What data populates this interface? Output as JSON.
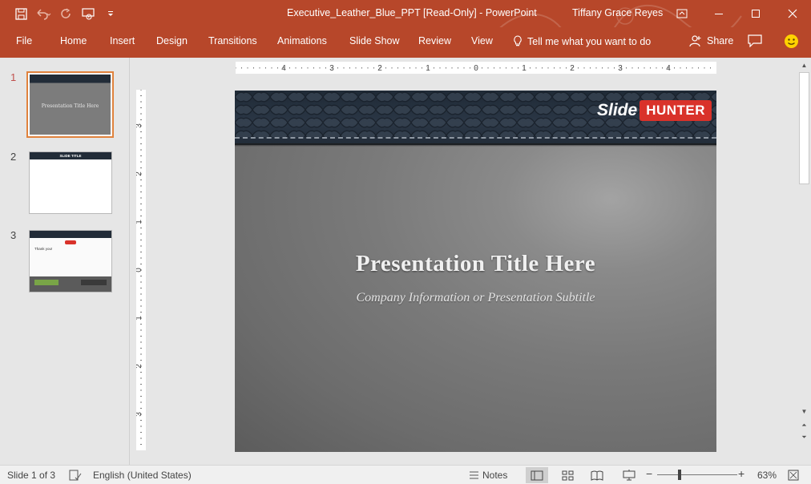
{
  "window": {
    "title": "Executive_Leather_Blue_PPT [Read-Only]  -  PowerPoint",
    "user": "Tiffany Grace Reyes"
  },
  "ribbon": {
    "tabs": [
      "File",
      "Home",
      "Insert",
      "Design",
      "Transitions",
      "Animations",
      "Slide Show",
      "Review",
      "View"
    ],
    "tell_me": "Tell me what you want to do",
    "share": "Share"
  },
  "thumbnails": [
    {
      "number": "1",
      "title": "Presentation Title Here"
    },
    {
      "number": "2",
      "title": "SLIDE TITLE"
    },
    {
      "number": "3",
      "title": "Thank you!"
    }
  ],
  "slide": {
    "title": "Presentation Title Here",
    "subtitle": "Company Information or Presentation Subtitle",
    "logo_word": "Slide",
    "logo_badge": "HUNTER"
  },
  "rulers": {
    "horizontal": [
      "4",
      "3",
      "2",
      "1",
      "0",
      "1",
      "2",
      "3",
      "4"
    ],
    "vertical": [
      "3",
      "2",
      "1",
      "0",
      "1",
      "2",
      "3"
    ]
  },
  "status": {
    "slide_info": "Slide 1 of 3",
    "language": "English (United States)",
    "notes": "Notes",
    "zoom": "63%"
  },
  "colors": {
    "accent": "#b7472a",
    "logo_red": "#d9322a",
    "active_thumb_border": "#e0823d"
  }
}
